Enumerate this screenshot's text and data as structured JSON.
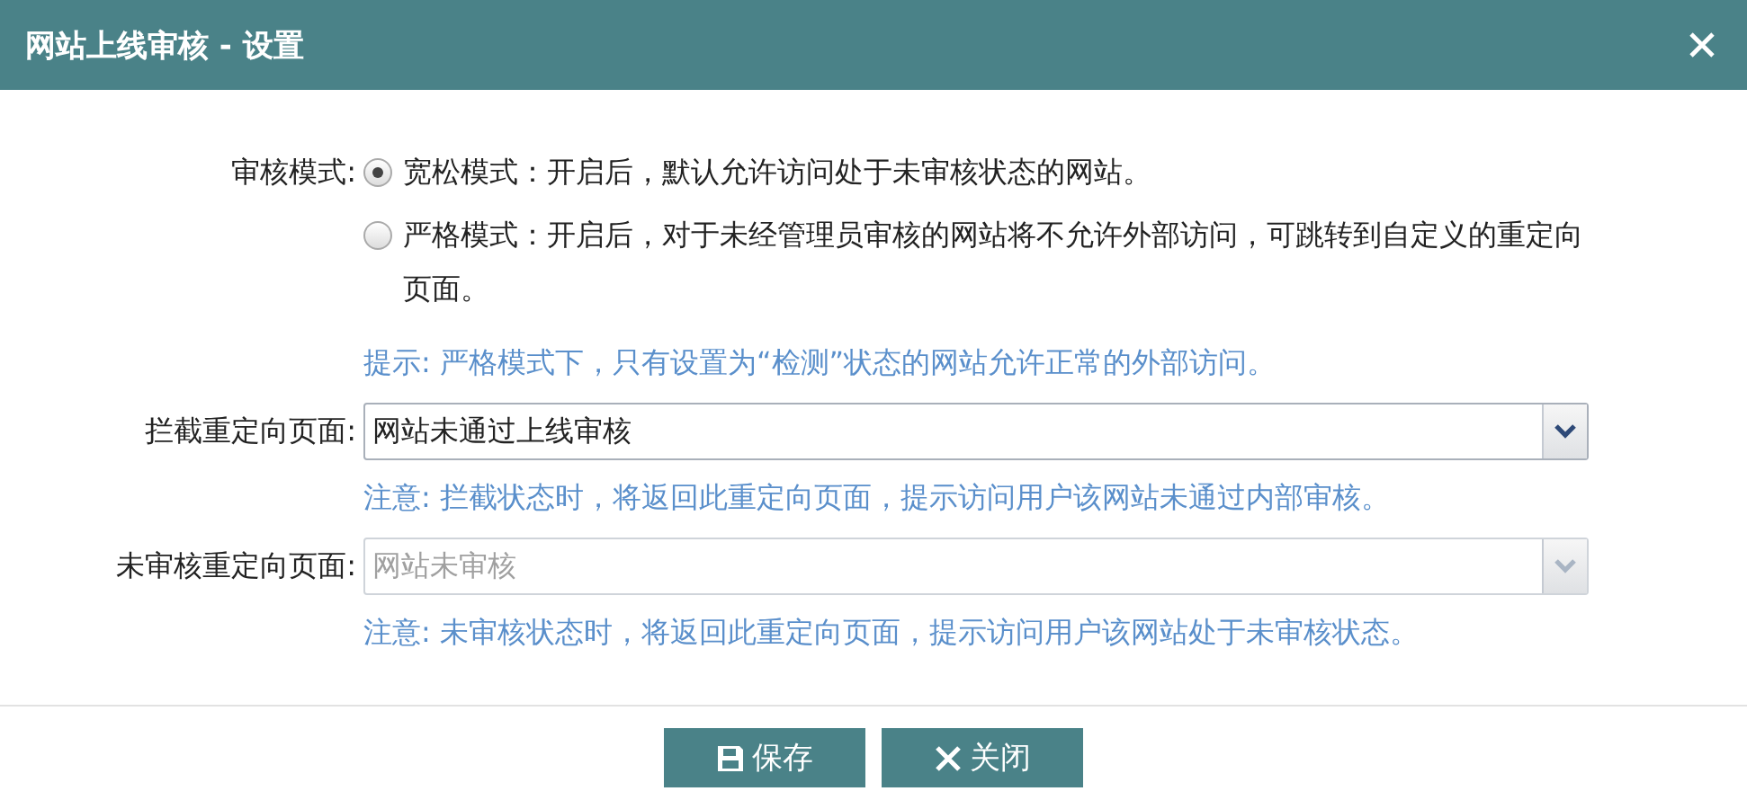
{
  "window": {
    "title": "网站上线审核 - 设置"
  },
  "mode": {
    "label": "审核模式:",
    "options": [
      {
        "label": "宽松模式：开启后，默认允许访问处于未审核状态的网站。",
        "selected": true
      },
      {
        "label": "严格模式：开启后，对于未经管理员审核的网站将不允许外部访问，可跳转到自定义的重定向页面。",
        "selected": false
      }
    ]
  },
  "tip": "提示: 严格模式下，只有设置为“检测”状态的网站允许正常的外部访问。",
  "fields": [
    {
      "label": "拦截重定向页面:",
      "value": "网站未通过上线审核",
      "disabled": false,
      "note": "注意: 拦截状态时，将返回此重定向页面，提示访问用户该网站未通过内部审核。"
    },
    {
      "label": "未审核重定向页面:",
      "value": "网站未审核",
      "disabled": true,
      "note": "注意: 未审核状态时，将返回此重定向页面，提示访问用户该网站处于未审核状态。"
    }
  ],
  "buttons": [
    {
      "kind": "save",
      "label": "保存"
    },
    {
      "kind": "close",
      "label": "关闭"
    }
  ]
}
